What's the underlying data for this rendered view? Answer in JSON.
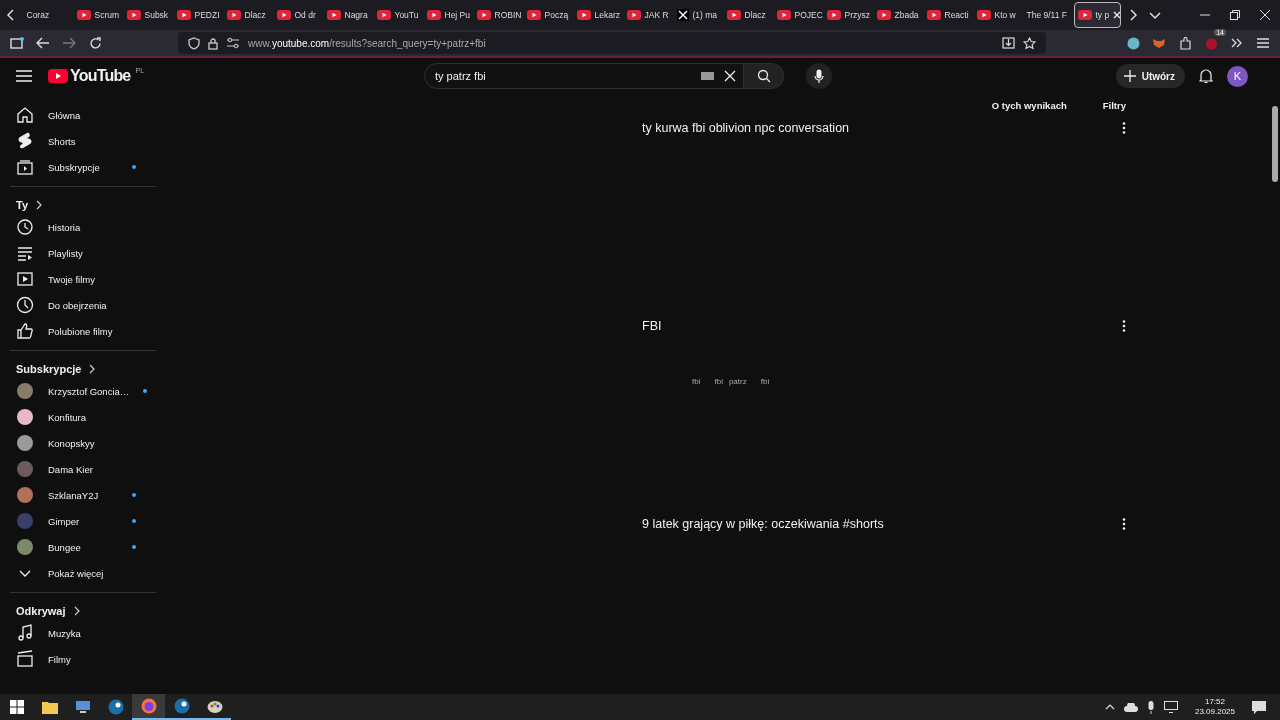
{
  "browser": {
    "tabs": [
      {
        "label": "Coraz",
        "kind": "none",
        "selected": false
      },
      {
        "label": "Scrum",
        "kind": "youtube",
        "selected": false
      },
      {
        "label": "Subsk",
        "kind": "youtube",
        "selected": false
      },
      {
        "label": "PEDZI",
        "kind": "youtube",
        "selected": false
      },
      {
        "label": "Dlacz",
        "kind": "youtube",
        "selected": false
      },
      {
        "label": "Od dr",
        "kind": "youtube",
        "selected": false
      },
      {
        "label": "Nagra",
        "kind": "youtube",
        "selected": false
      },
      {
        "label": "YouTu",
        "kind": "youtube",
        "selected": false
      },
      {
        "label": "Hej Pu",
        "kind": "youtube",
        "selected": false
      },
      {
        "label": "ROBIN",
        "kind": "youtube",
        "selected": false
      },
      {
        "label": "Począ",
        "kind": "youtube",
        "selected": false
      },
      {
        "label": "Lekarz",
        "kind": "youtube",
        "selected": false
      },
      {
        "label": "JAK R",
        "kind": "youtube",
        "selected": false
      },
      {
        "label": "(1) ma",
        "kind": "x",
        "selected": false
      },
      {
        "label": "Dlacz",
        "kind": "youtube",
        "selected": false
      },
      {
        "label": "POJEC",
        "kind": "youtube",
        "selected": false
      },
      {
        "label": "Przysz",
        "kind": "youtube",
        "selected": false
      },
      {
        "label": "Zbada",
        "kind": "youtube",
        "selected": false
      },
      {
        "label": "Reacti",
        "kind": "youtube",
        "selected": false
      },
      {
        "label": "Kto w",
        "kind": "youtube",
        "selected": false
      },
      {
        "label": "The 9/11 F",
        "kind": "none",
        "selected": false
      },
      {
        "label": "ty p",
        "kind": "youtube",
        "selected": true
      }
    ],
    "url": "www.**youtube.com**/results?search_query=ty+patrz+fbi",
    "extension_badge": "14"
  },
  "youtube": {
    "logo": "YouTube",
    "region": "PL",
    "search": {
      "value": "ty patrz fbi"
    },
    "create_button": "Utwórz",
    "avatar_letter": "K",
    "sidebar": {
      "sections": [
        {
          "items": [
            {
              "label": "Główna",
              "new": false
            },
            {
              "label": "Shorts",
              "new": false
            },
            {
              "label": "Subskrypcje",
              "new": true
            }
          ]
        },
        {
          "title": "Ty",
          "items": [
            {
              "label": "Historia",
              "new": false
            },
            {
              "label": "Playlisty",
              "new": false
            },
            {
              "label": "Twoje filmy",
              "new": false
            },
            {
              "label": "Do obejrzenia",
              "new": false
            },
            {
              "label": "Polubione filmy",
              "new": false
            }
          ]
        },
        {
          "title": "Subskrypcje",
          "items": [
            {
              "label": "Krzysztof Goncia…",
              "new": true
            },
            {
              "label": "Konfitura",
              "new": false
            },
            {
              "label": "Konopskyy",
              "new": false
            },
            {
              "label": "Dama Kier",
              "new": false
            },
            {
              "label": "SzklanaY2J",
              "new": true
            },
            {
              "label": "Gimper",
              "new": true
            },
            {
              "label": "Bungee",
              "new": true
            }
          ],
          "show_more": "Pokaż więcej"
        },
        {
          "title": "Odkrywaj",
          "items": [
            {
              "label": "Muzyka",
              "new": false
            },
            {
              "label": "Filmy",
              "new": false
            }
          ]
        }
      ]
    },
    "filters": {
      "about": "O tych wynikach",
      "filters": "Filtry"
    },
    "results": [
      {
        "title": "ty kurwa fbi oblivion npc conversation"
      },
      {
        "title": "FBI",
        "snippet": [
          "fbi",
          "fbi",
          "patrz",
          "fbi"
        ]
      },
      {
        "title": "9 latek grający w piłkę: oczekiwania #shorts"
      }
    ]
  },
  "taskbar": {
    "time": "17:52",
    "date": "23.09.2025"
  }
}
